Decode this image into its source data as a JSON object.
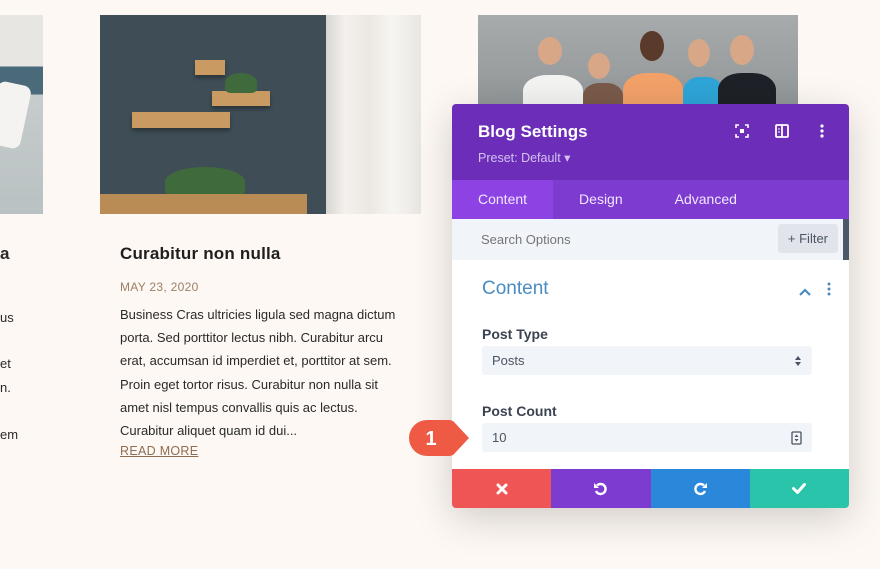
{
  "blog": {
    "left_fragment": {
      "title_tail": "a",
      "lines": [
        "us",
        "et",
        "n.",
        "em"
      ]
    },
    "post": {
      "title": "Curabitur non nulla",
      "date": "MAY 23, 2020",
      "excerpt": "Business Cras ultricies ligula sed magna dictum porta. Sed porttitor lectus nibh. Curabitur arcu erat, accumsan id imperdiet et, porttitor at sem. Proin eget tortor risus. Curabitur non nulla sit amet nisl tempus convallis quis ac lectus. Curabitur aliquet quam id dui...",
      "read_more": "READ MORE"
    }
  },
  "modal": {
    "title": "Blog Settings",
    "preset": "Preset: Default ▾",
    "header_icons": [
      "focus-icon",
      "split-view-icon",
      "more-vertical-icon"
    ],
    "tabs": [
      {
        "label": "Content",
        "active": true
      },
      {
        "label": "Design",
        "active": false
      },
      {
        "label": "Advanced",
        "active": false
      }
    ],
    "search": {
      "placeholder": "Search Options",
      "filter_label": "+ Filter"
    },
    "section": {
      "title": "Content",
      "fields": [
        {
          "label": "Post Type",
          "value": "Posts",
          "type": "select"
        },
        {
          "label": "Post Count",
          "value": "10",
          "type": "number"
        }
      ]
    },
    "actions": [
      {
        "name": "cancel",
        "icon": "close-icon",
        "color": "#ef5555"
      },
      {
        "name": "undo",
        "icon": "undo-icon",
        "color": "#7e3bd0"
      },
      {
        "name": "redo",
        "icon": "redo-icon",
        "color": "#2b87da"
      },
      {
        "name": "save",
        "icon": "check-icon",
        "color": "#29c4a9"
      }
    ]
  },
  "annotation": {
    "number": "1",
    "color": "#ee5a44"
  },
  "colors": {
    "header": "#6c2eb9",
    "tabs": "#7e3bd0",
    "active_tab": "#8d42e3",
    "section_title": "#4a8cc0",
    "page_bg": "#fdf8f3"
  }
}
